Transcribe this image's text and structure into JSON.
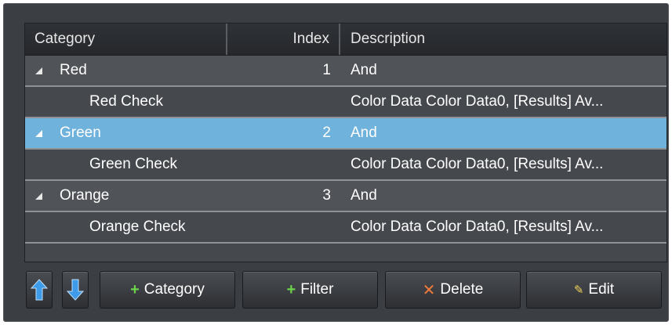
{
  "table": {
    "columns": [
      "Category",
      "Index",
      "Description"
    ],
    "rows": [
      {
        "name": "Red",
        "index": "1",
        "description": "And",
        "expanded": true
      },
      {
        "name": "Red Check",
        "index": "",
        "description": "Color Data Color Data0, [Results] Av..."
      },
      {
        "name": "Green",
        "index": "2",
        "description": "And",
        "expanded": true,
        "selected": true
      },
      {
        "name": "Green Check",
        "index": "",
        "description": "Color Data Color Data0, [Results] Av..."
      },
      {
        "name": "Orange",
        "index": "3",
        "description": "And",
        "expanded": true
      },
      {
        "name": "Orange Check",
        "index": "",
        "description": "Color Data Color Data0, [Results] Av..."
      }
    ]
  },
  "toolbar": {
    "move_up_icon": "arrow-up-icon",
    "move_down_icon": "arrow-down-icon",
    "category_label": "Category",
    "filter_label": "Filter",
    "delete_label": "Delete",
    "edit_label": "Edit"
  },
  "colors": {
    "selected_row": "#6fb2dc",
    "panel_bg": "#3b3e43",
    "arrow_blue": "#3d9be9"
  }
}
